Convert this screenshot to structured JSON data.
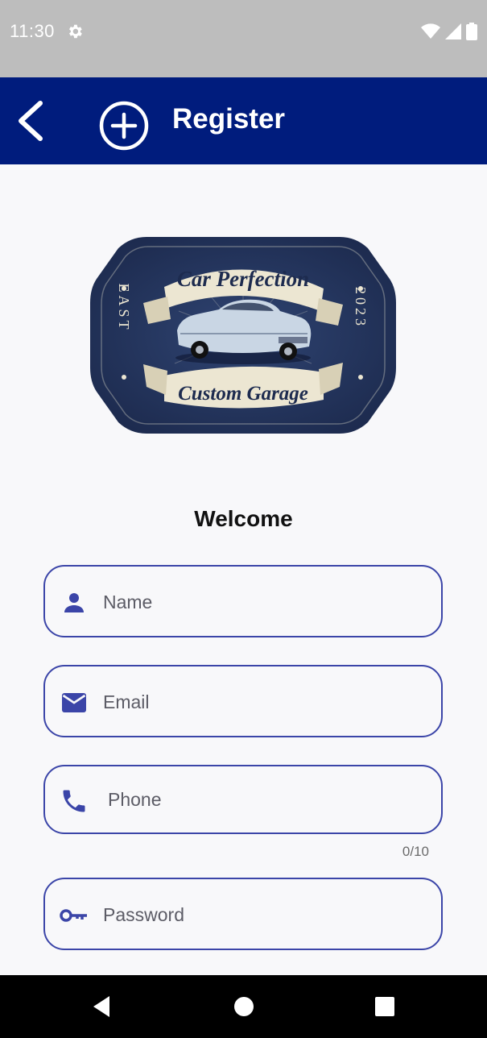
{
  "status_bar": {
    "time": "11:30"
  },
  "app_bar": {
    "title": "Register",
    "color": "#001c7d"
  },
  "logo": {
    "top_text": "Car Perfection",
    "bottom_text": "Custom Garage",
    "left_text": "EAST",
    "right_text": "2023"
  },
  "form": {
    "welcome": "Welcome",
    "name_placeholder": "Name",
    "email_placeholder": "Email",
    "phone_placeholder": "Phone",
    "phone_counter": "0/10",
    "password_placeholder": "Password",
    "accent_color": "#3b45a8"
  },
  "nav": {
    "icons": [
      "back-triangle",
      "home-circle",
      "recents-square"
    ]
  }
}
